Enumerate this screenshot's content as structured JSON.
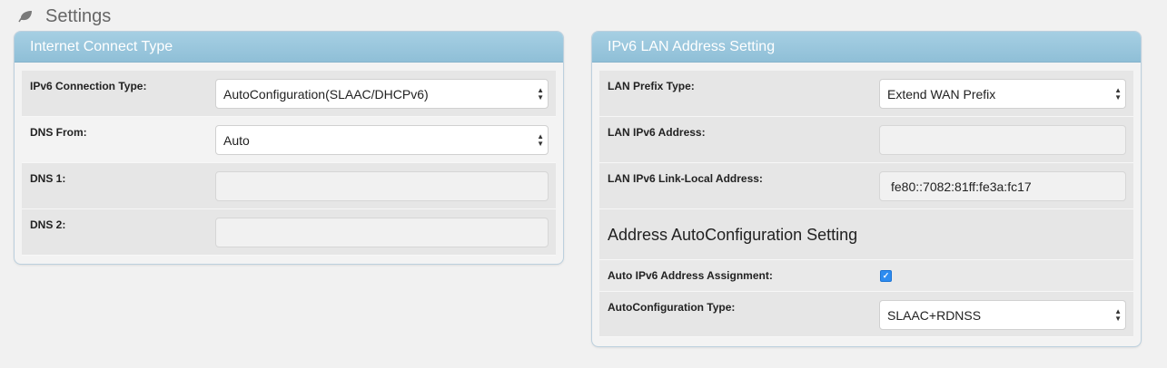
{
  "header": {
    "title": "Settings",
    "icon": "leaf-icon"
  },
  "left_panel": {
    "title": "Internet Connect Type",
    "rows": [
      {
        "label": "IPv6 Connection Type:",
        "value": "AutoConfiguration(SLAAC/DHCPv6)"
      },
      {
        "label": "DNS From:",
        "value": "Auto"
      },
      {
        "label": "DNS 1:",
        "value": ""
      },
      {
        "label": "DNS 2:",
        "value": ""
      }
    ]
  },
  "right_panel": {
    "title": "IPv6 LAN Address Setting",
    "rows": [
      {
        "label": "LAN Prefix Type:",
        "value": "Extend WAN Prefix"
      },
      {
        "label": "LAN IPv6 Address:",
        "value": ""
      },
      {
        "label": "LAN IPv6 Link-Local Address:",
        "value": "fe80::7082:81ff:fe3a:fc17"
      }
    ],
    "section_heading": "Address AutoConfiguration Setting",
    "auto_rows": [
      {
        "label": "Auto IPv6 Address Assignment:",
        "checked": true
      },
      {
        "label": "AutoConfiguration Type:",
        "value": "SLAAC+RDNSS"
      }
    ]
  },
  "colors": {
    "header_blue": "#97c6dd",
    "checkbox_blue": "#2d8cf0"
  }
}
